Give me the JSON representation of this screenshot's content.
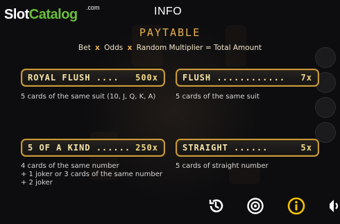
{
  "watermark": {
    "brand_part1": "Slot",
    "brand_part2": "Catalog",
    "brand_suffix": ".com"
  },
  "header": {
    "title": "INFO"
  },
  "paytable": {
    "title": "PAYTABLE",
    "formula": {
      "term1": "Bet",
      "op1": "x",
      "term2": "Odds",
      "op2": "x",
      "term3": "Random Multiplier",
      "op3": "=",
      "term4": "Total Amount"
    },
    "hands": [
      {
        "name": "ROYAL FLUSH ....",
        "multiplier": "500x",
        "desc_lines": [
          "5 cards of the same suit (10, J, Q, K, A)"
        ]
      },
      {
        "name": "FLUSH ............",
        "multiplier": "7x",
        "desc_lines": [
          "5 cards of the same suit"
        ]
      },
      {
        "name": "5 OF A KIND ......",
        "multiplier": "250x",
        "desc_lines": [
          "4 cards of the same number",
          "+ 1 joker or 3 cards of the same number",
          "+ 2 joker"
        ]
      },
      {
        "name": "STRAIGHT ......",
        "multiplier": "5x",
        "desc_lines": [
          "5 cards of straight number"
        ]
      }
    ]
  },
  "toolbar": {
    "items": [
      {
        "icon": "history-icon",
        "active": false
      },
      {
        "icon": "settings-icon",
        "active": false
      },
      {
        "icon": "info-icon",
        "active": true
      },
      {
        "icon": "sound-icon",
        "active": false
      }
    ]
  },
  "colors": {
    "gold": "#c99a3c",
    "title_gold": "#e7b24a",
    "active_icon": "#f2c200",
    "brand_green": "#6bbf3a"
  }
}
